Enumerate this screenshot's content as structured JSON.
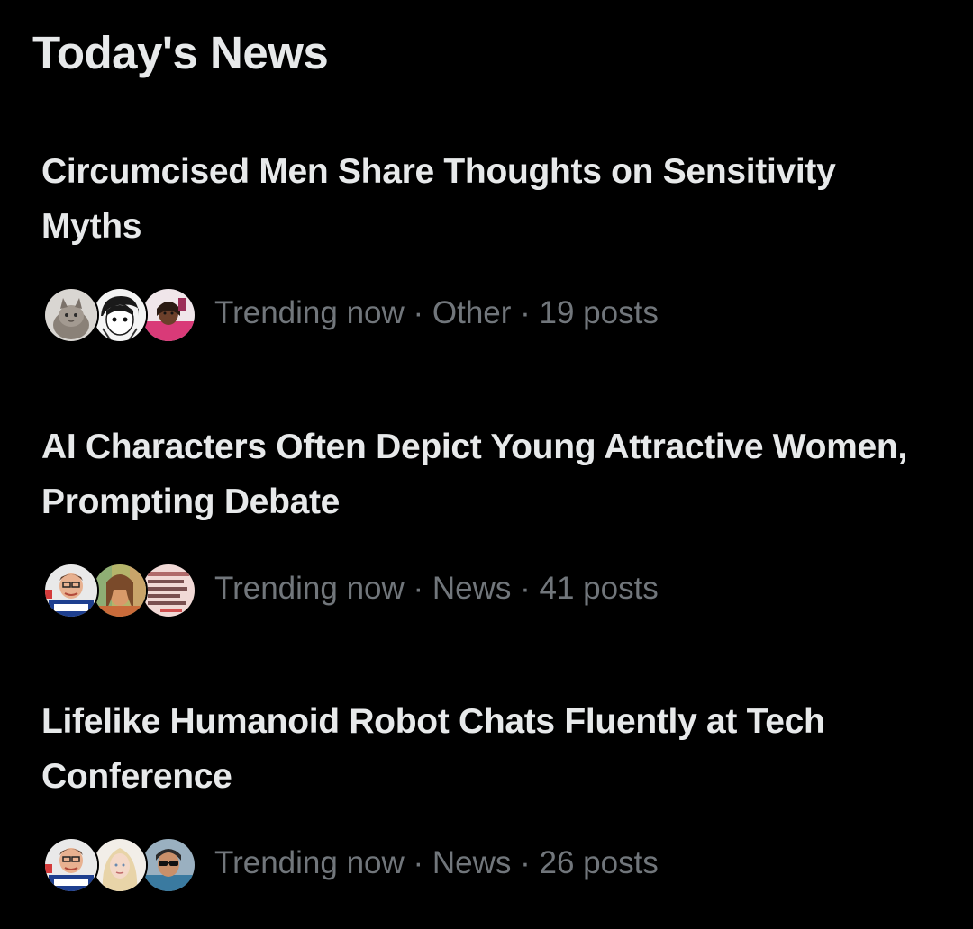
{
  "header": {
    "title": "Today's News"
  },
  "items": [
    {
      "title": "Circumcised Men Share Thoughts on Sensitivity Myths",
      "meta": "Trending now · Other · 19 posts",
      "avatars": [
        "cat-avatar",
        "manga-avatar",
        "person-pink-avatar"
      ]
    },
    {
      "title": "AI Characters Often Depict Young Attractive Women, Prompting Debate",
      "meta": "Trending now · News · 41 posts",
      "avatars": [
        "cartoon-man-avatar",
        "colorful-portrait-avatar",
        "text-document-avatar"
      ]
    },
    {
      "title": "Lifelike Humanoid Robot Chats Fluently at Tech Conference",
      "meta": "Trending now · News · 26 posts",
      "avatars": [
        "cartoon-man-avatar",
        "blonde-woman-avatar",
        "sunglasses-person-avatar"
      ]
    }
  ],
  "colors": {
    "background": "#000000",
    "primary_text": "#e7e9ea",
    "secondary_text": "#71767b"
  }
}
